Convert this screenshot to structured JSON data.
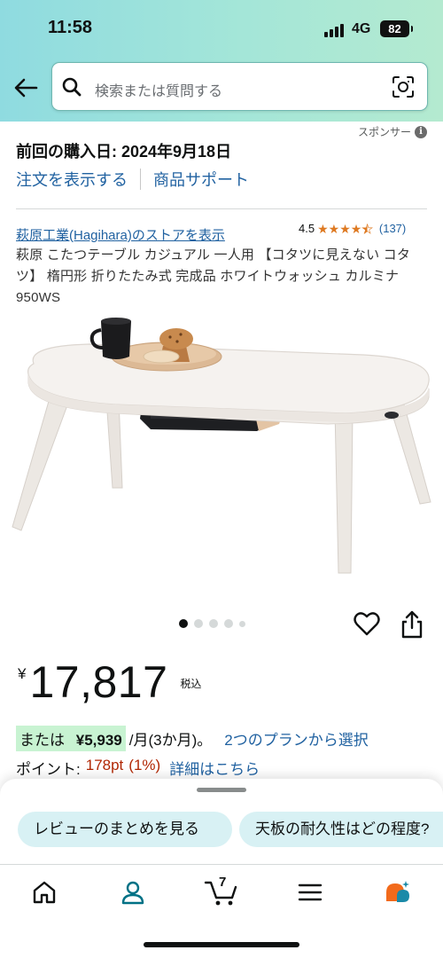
{
  "status_bar": {
    "time": "11:58",
    "network": "4G",
    "battery": "82"
  },
  "header": {
    "back_icon": "arrow-left-icon",
    "search_placeholder": "検索または質問する",
    "camera_icon": "camera-scan-icon"
  },
  "purchase_info": {
    "last_purchase": "前回の購入日: 2024年9月18日",
    "view_order": "注文を表示する",
    "product_support": "商品サポート",
    "sponsored": "スポンサー"
  },
  "product": {
    "store_link": "萩原工業(Hagihara)のストアを表示",
    "rating_value": "4.5",
    "rating_stars": 4.5,
    "rating_count": "(137)",
    "title": "萩原 こたつテーブル カジュアル 一人用 【コタツに見えない コタツ】 楕円形 折りたたみ式 完成品 ホワイトウォッシュ カルミナ950WS",
    "image_count": 5,
    "active_image": 1
  },
  "price": {
    "currency": "¥",
    "amount": "17,817",
    "tax_label": "税込"
  },
  "installment": {
    "prefix": "または",
    "amount": "¥5,939",
    "suffix": "/月(3か月)。",
    "plans_link": "2つのプランから選択"
  },
  "points": {
    "label": "ポイント:",
    "value": "178pt",
    "percent": "(1%)",
    "details_link": "詳細はこちら"
  },
  "suggestions": {
    "chip1": "レビューのまとめを見る",
    "chip2": "天板の耐久性はどの程度?"
  },
  "nav": {
    "items": [
      "home-icon",
      "account-icon",
      "cart-icon",
      "menu-icon",
      "ai-assistant-icon"
    ],
    "cart_count": "7"
  },
  "colors": {
    "link": "#2162a1",
    "star": "#de7921",
    "points_red": "#b12704",
    "chip_bg": "#d8f1f4",
    "highlight": "#c8f3d2",
    "nav_active": "#007185"
  }
}
